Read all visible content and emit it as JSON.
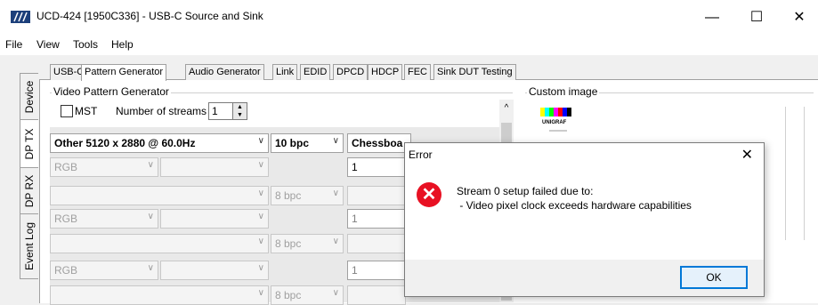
{
  "window": {
    "title": "UCD-424 [1950C336] - USB-C Source and Sink",
    "minimize": "—",
    "maximize": "☐",
    "close": "✕"
  },
  "menu": [
    "File",
    "View",
    "Tools",
    "Help"
  ],
  "side_tabs": [
    "Device",
    "DP TX",
    "DP RX",
    "Event Log"
  ],
  "top_tabs": [
    "USB-C",
    "Pattern Generator",
    "Audio Generator",
    "Link",
    "EDID",
    "DPCD",
    "HDCP",
    "FEC",
    "Sink DUT Testing"
  ],
  "video_group": {
    "title": "Video Pattern Generator",
    "mst_label": "MST",
    "streams_label": "Number of streams",
    "streams_value": "1"
  },
  "stream_rows": {
    "timing": "Other 5120 x 2880 @ 60.0Hz",
    "bpc": "10 bpc",
    "pattern": "Chessboa",
    "color_format": "RGB",
    "bpc_disabled": "8 bpc",
    "field_value": "1"
  },
  "custom_image": {
    "title": "Custom image",
    "thumb_text": "UNIGRAF"
  },
  "dialog": {
    "title": "Error",
    "close": "✕",
    "icon": "error-icon",
    "message_line1": "Stream 0 setup failed due to:",
    "message_line2": " - Video pixel clock exceeds hardware capabilities",
    "ok_label": "OK"
  },
  "colors": {
    "error_red": "#e81123",
    "focus_blue": "#0078d7"
  }
}
